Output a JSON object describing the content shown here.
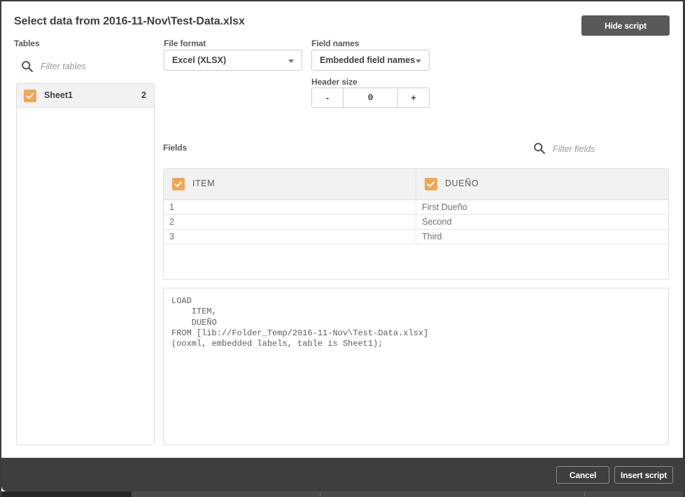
{
  "dialog": {
    "title": "Select data from 2016-11-Nov\\Test-Data.xlsx",
    "hide_script_label": "Hide script",
    "accent_color": "#f2a654",
    "footer_color": "#3e3e3e",
    "button_color": "#595959"
  },
  "tables_panel": {
    "label": "Tables",
    "filter_placeholder": "Filter tables",
    "filter_value": "",
    "search_icon": "search-icon",
    "rows": [
      {
        "name": "Sheet1",
        "count": "2",
        "checked": true
      }
    ]
  },
  "settings": {
    "file_format": {
      "label": "File format",
      "value": "Excel (XLSX)",
      "options": [
        "Excel (XLSX)"
      ]
    },
    "field_names": {
      "label": "Field names",
      "value": "Embedded field names",
      "options": [
        "Embedded field names"
      ]
    },
    "header_size": {
      "label": "Header size",
      "value": "0",
      "minus_label": "-",
      "plus_label": "+"
    }
  },
  "fields_panel": {
    "label": "Fields",
    "filter_placeholder": "Filter fields",
    "filter_value": "",
    "search_icon": "search-icon",
    "columns": [
      {
        "name": "ITEM",
        "checked": true
      },
      {
        "name": "DUEÑO",
        "checked": true
      }
    ],
    "rows": [
      [
        "1",
        "First Dueño"
      ],
      [
        "2",
        "Second"
      ],
      [
        "3",
        "Third"
      ]
    ]
  },
  "script_panel": {
    "text": "LOAD\n    ITEM,\n    DUEÑO\nFROM [lib://Folder_Temp/2016-11-Nov\\Test-Data.xlsx]\n(ooxml, embedded labels, table is Sheet1);"
  },
  "footer": {
    "cancel_label": "Cancel",
    "insert_label": "Insert script"
  }
}
